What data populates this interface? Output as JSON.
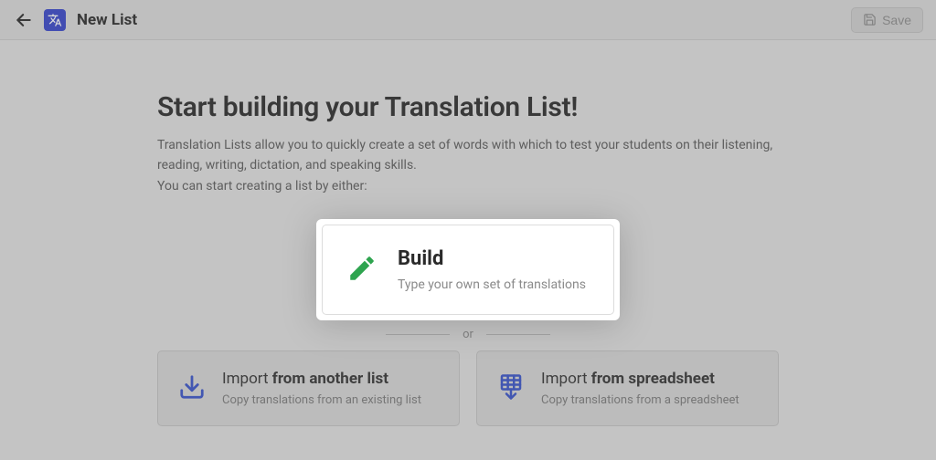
{
  "header": {
    "title": "New List",
    "save_label": "Save"
  },
  "content": {
    "heading": "Start building your Translation List!",
    "description1": "Translation Lists allow you to quickly create a set of words with which to test your students on their listening, reading, writing, dictation, and speaking skills.",
    "description2": "You can start creating a list by either:"
  },
  "build": {
    "title": "Build",
    "desc": "Type your own set of translations"
  },
  "divider": {
    "label": "or"
  },
  "import_list": {
    "prefix": "Import ",
    "suffix": "from another list",
    "desc": "Copy translations from an existing list"
  },
  "import_sheet": {
    "prefix": "Import ",
    "suffix": "from spreadsheet",
    "desc": "Copy translations from a spreadsheet"
  }
}
